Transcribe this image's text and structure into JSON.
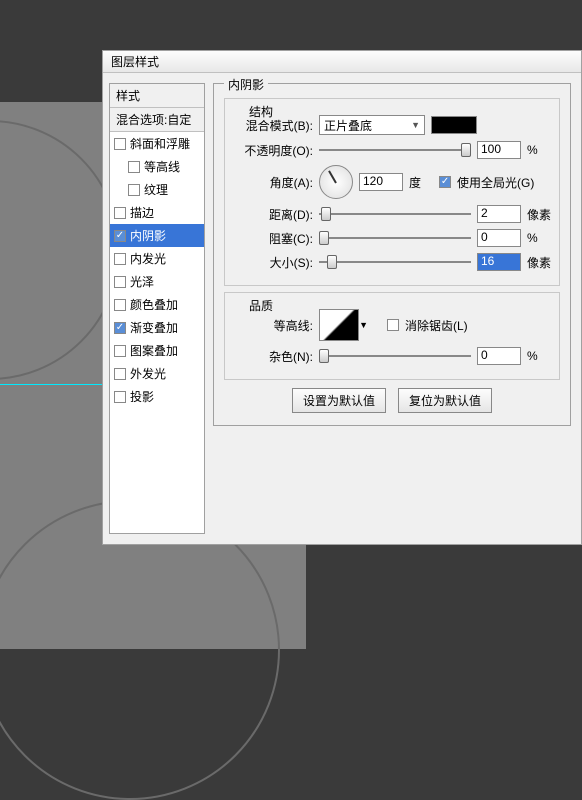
{
  "dialog": {
    "title": "图层样式"
  },
  "styles": {
    "header": "样式",
    "blend_opts": "混合选项:自定",
    "items": [
      {
        "label": "斜面和浮雕",
        "checked": false,
        "indent": false
      },
      {
        "label": "等高线",
        "checked": false,
        "indent": true
      },
      {
        "label": "纹理",
        "checked": false,
        "indent": true
      },
      {
        "label": "描边",
        "checked": false,
        "indent": false
      },
      {
        "label": "内阴影",
        "checked": true,
        "indent": false,
        "selected": true
      },
      {
        "label": "内发光",
        "checked": false,
        "indent": false
      },
      {
        "label": "光泽",
        "checked": false,
        "indent": false
      },
      {
        "label": "颜色叠加",
        "checked": false,
        "indent": false
      },
      {
        "label": "渐变叠加",
        "checked": true,
        "indent": false
      },
      {
        "label": "图案叠加",
        "checked": false,
        "indent": false
      },
      {
        "label": "外发光",
        "checked": false,
        "indent": false
      },
      {
        "label": "投影",
        "checked": false,
        "indent": false
      }
    ]
  },
  "panel": {
    "title": "内阴影",
    "structure": {
      "legend": "结构",
      "blend_mode_label": "混合模式(B):",
      "blend_mode_value": "正片叠底",
      "swatch_color": "#000000",
      "opacity_label": "不透明度(O):",
      "opacity_value": "100",
      "opacity_unit": "%",
      "angle_label": "角度(A):",
      "angle_value": "120",
      "angle_unit": "度",
      "global_light_label": "使用全局光(G)",
      "global_light_checked": true,
      "distance_label": "距离(D):",
      "distance_value": "2",
      "distance_unit": "像素",
      "choke_label": "阻塞(C):",
      "choke_value": "0",
      "choke_unit": "%",
      "size_label": "大小(S):",
      "size_value": "16",
      "size_unit": "像素"
    },
    "quality": {
      "legend": "品质",
      "contour_label": "等高线:",
      "antialias_label": "消除锯齿(L)",
      "antialias_checked": false,
      "noise_label": "杂色(N):",
      "noise_value": "0",
      "noise_unit": "%"
    },
    "buttons": {
      "default": "设置为默认值",
      "reset": "复位为默认值"
    }
  }
}
